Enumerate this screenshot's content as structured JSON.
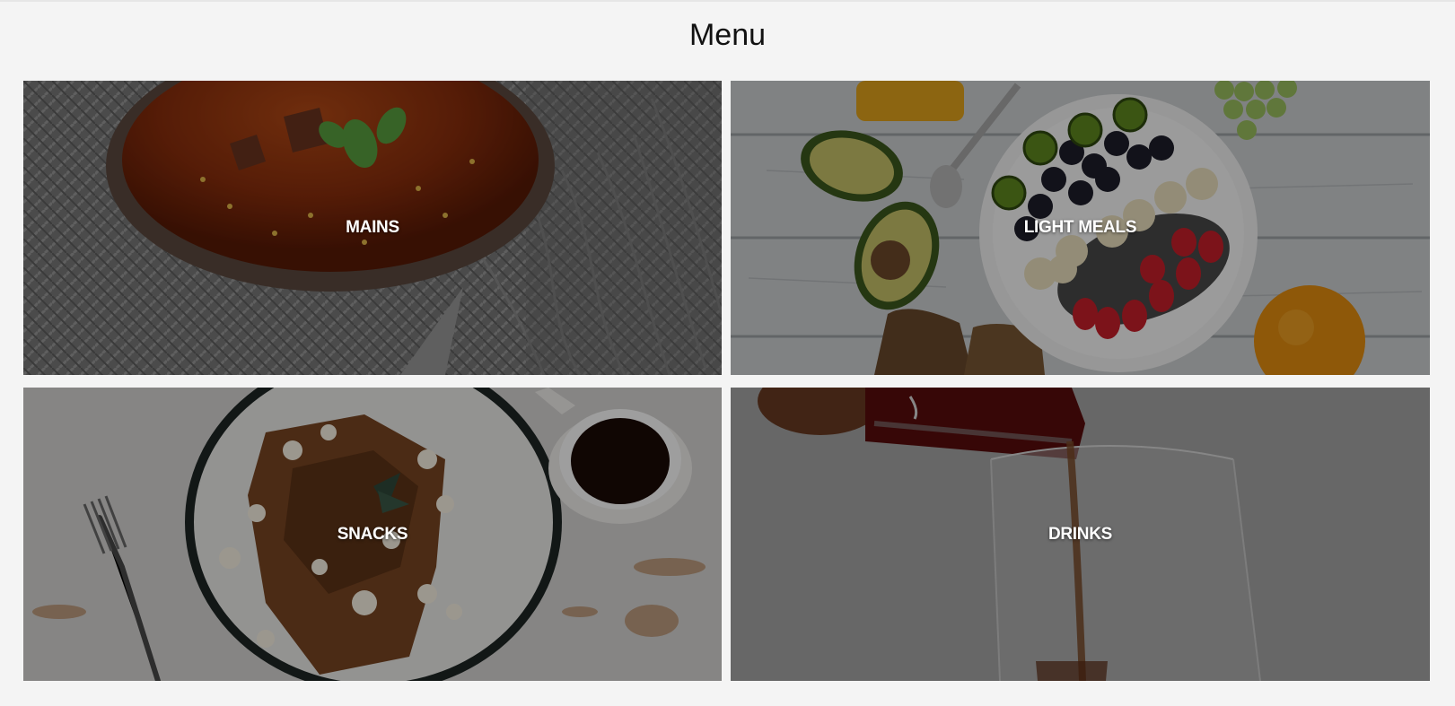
{
  "page": {
    "title": "Menu"
  },
  "categories": [
    {
      "label": "MAINS",
      "icon": "soup-bowl-photo"
    },
    {
      "label": "LIGHT MEALS",
      "icon": "fruit-bowl-photo"
    },
    {
      "label": "SNACKS",
      "icon": "french-toast-photo"
    },
    {
      "label": "DRINKS",
      "icon": "pouring-drink-photo"
    }
  ],
  "colors": {
    "background": "#f4f4f4",
    "title": "#111111",
    "tile_label": "#ffffff"
  }
}
